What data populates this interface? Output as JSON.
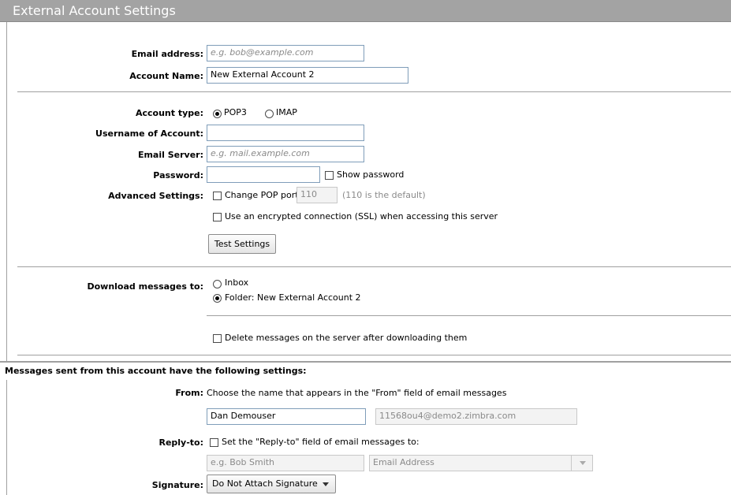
{
  "header": {
    "title": "External Account Settings"
  },
  "account": {
    "email_label": "Email address:",
    "email_placeholder": "e.g. bob@example.com",
    "name_label": "Account Name:",
    "name_value": "New External Account 2"
  },
  "server": {
    "type_label": "Account type:",
    "pop3_label": "POP3",
    "imap_label": "IMAP",
    "selected_type": "POP3",
    "username_label": "Username of Account:",
    "username_value": "",
    "server_label": "Email Server:",
    "server_placeholder": "e.g. mail.example.com",
    "password_label": "Password:",
    "show_password_label": "Show password",
    "advanced_label": "Advanced Settings:",
    "change_port_label": "Change POP port",
    "port_value": "110",
    "port_hint": "(110 is the default)",
    "ssl_label": "Use an encrypted connection (SSL) when accessing this server",
    "test_button": "Test Settings"
  },
  "download": {
    "label": "Download messages to:",
    "inbox_label": "Inbox",
    "folder_label": "Folder: New External Account 2",
    "selected": "folder",
    "delete_label": "Delete messages on the server after downloading them"
  },
  "sending": {
    "section_title": "Messages sent from this account have the following settings:",
    "from_label": "From:",
    "from_hint": "Choose the name that appears in the \"From\" field of email messages",
    "from_name": "Dan Demouser",
    "from_address": "11568ou4@demo2.zimbra.com",
    "reply_label": "Reply-to:",
    "reply_check_label": "Set the \"Reply-to\" field of email messages to:",
    "reply_name_placeholder": "e.g. Bob Smith",
    "reply_address_placeholder": "Email Address",
    "signature_label": "Signature:",
    "signature_value": "Do Not Attach Signature"
  }
}
